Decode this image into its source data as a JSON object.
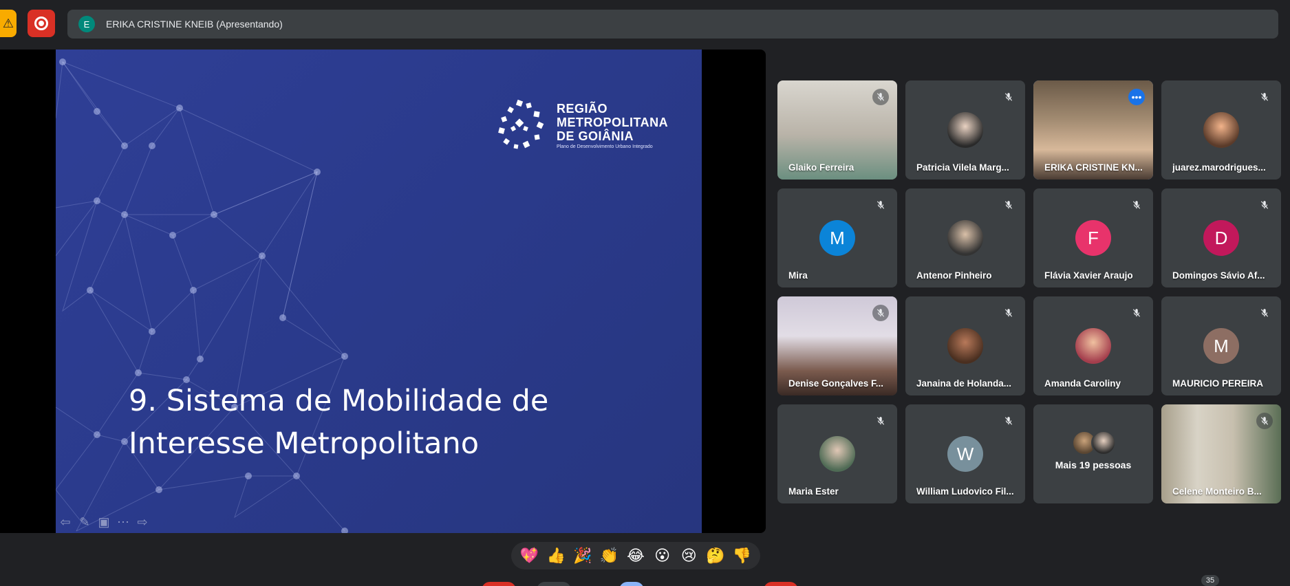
{
  "presenter": {
    "avatar_letter": "E",
    "label": "ERIKA CRISTINE KNEIB (Apresentando)"
  },
  "slide": {
    "logo_line1": "REGIÃO",
    "logo_line2": "METROPOLITANA",
    "logo_line3": "DE GOIÂNIA",
    "logo_subtitle": "Plano de Desenvolvimento Urbano Integrado",
    "title_line1": "9. Sistema de Mobilidade de",
    "title_line2": "Interesse Metropolitano"
  },
  "participants": [
    {
      "name": "Glaiko Ferreira",
      "type": "video"
    },
    {
      "name": "Patricia Vilela Marg...",
      "type": "photo"
    },
    {
      "name": "ERIKA CRISTINE KN...",
      "type": "video",
      "active": true
    },
    {
      "name": "juarez.marodrigues...",
      "type": "photo"
    },
    {
      "name": "Mira",
      "type": "letter",
      "letter": "M",
      "color": "#0b84d8"
    },
    {
      "name": "Antenor Pinheiro",
      "type": "photo"
    },
    {
      "name": "Flávia Xavier Araujo",
      "type": "letter",
      "letter": "F",
      "color": "#e8336b"
    },
    {
      "name": "Domingos Sávio Af...",
      "type": "letter",
      "letter": "D",
      "color": "#c2185b"
    },
    {
      "name": "Denise Gonçalves F...",
      "type": "video"
    },
    {
      "name": "Janaina de Holanda...",
      "type": "photo"
    },
    {
      "name": "Amanda Caroliny",
      "type": "photo"
    },
    {
      "name": "MAURICIO PEREIRA",
      "type": "letter",
      "letter": "M",
      "color": "#8d6e63"
    },
    {
      "name": "Maria Ester",
      "type": "photo"
    },
    {
      "name": "William Ludovico Fil...",
      "type": "letter",
      "letter": "W",
      "color": "#78909c"
    },
    {
      "name": "Mais 19 pessoas",
      "type": "more"
    },
    {
      "name": "Celene Monteiro B...",
      "type": "video"
    }
  ],
  "reactions": [
    "💖",
    "👍",
    "🎉",
    "👏",
    "😂",
    "😮",
    "😢",
    "🤔",
    "👎"
  ],
  "participant_count": "35",
  "colors": {
    "background": "#202124",
    "tile": "#3c4043",
    "slide_blue": "#2b3a8e",
    "active_outline": "#8ab4f8",
    "record_red": "#d93025"
  }
}
